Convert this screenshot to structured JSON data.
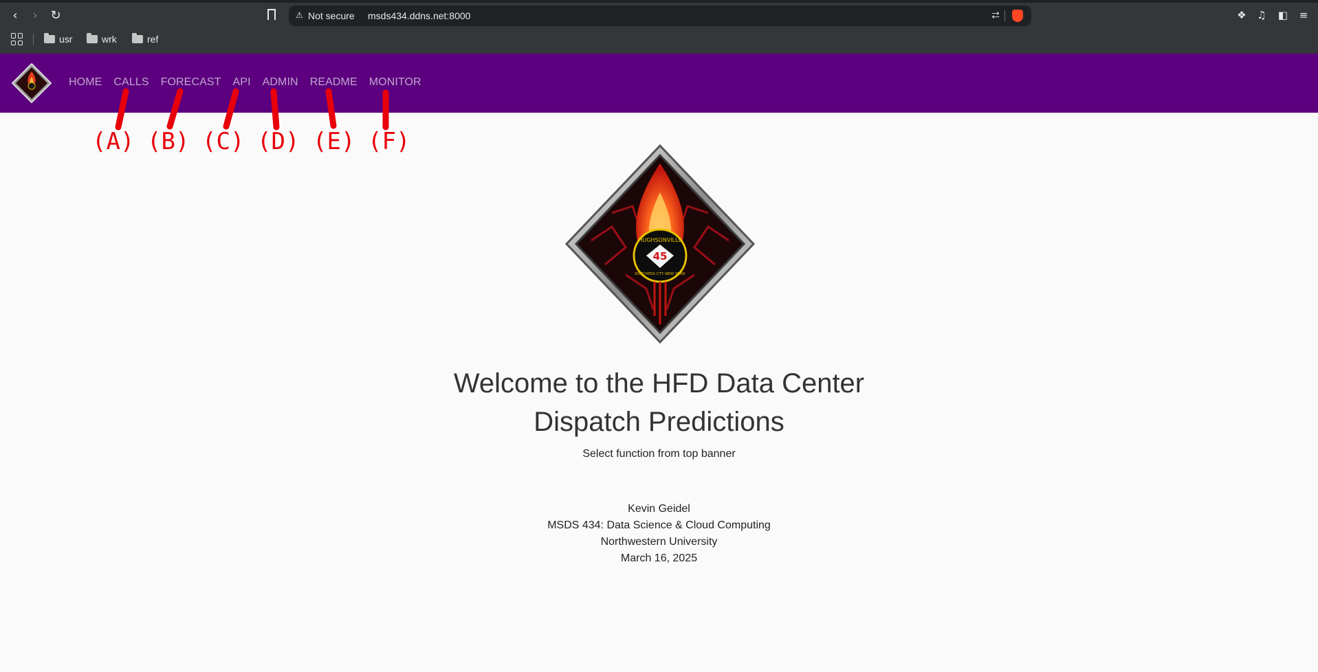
{
  "browser": {
    "security_label": "Not secure",
    "url": "msds434.ddns.net:8000",
    "bookmarks": [
      {
        "label": "usr"
      },
      {
        "label": "wrk"
      },
      {
        "label": "ref"
      }
    ]
  },
  "site": {
    "nav": [
      {
        "label": "HOME"
      },
      {
        "label": "CALLS"
      },
      {
        "label": "FORECAST"
      },
      {
        "label": "API"
      },
      {
        "label": "ADMIN"
      },
      {
        "label": "README"
      },
      {
        "label": "MONITOR"
      }
    ],
    "badge_text_top": "HUGHSONVILLE",
    "badge_number": "45",
    "badge_text_bottom": "DUTCHESS CTY NEW YORK",
    "title_line1": "Welcome to the HFD Data Center",
    "title_line2": "Dispatch Predictions",
    "subtitle": "Select function from top banner",
    "author": "Kevin Geidel",
    "course": "MSDS 434: Data Science & Cloud Computing",
    "school": "Northwestern University",
    "date": "March 16, 2025"
  },
  "annotations": [
    {
      "label": "(A)"
    },
    {
      "label": "(B)"
    },
    {
      "label": "(C)"
    },
    {
      "label": "(D)"
    },
    {
      "label": "(E)"
    },
    {
      "label": "(F)"
    }
  ],
  "colors": {
    "banner": "#5c007f",
    "nav_text": "#c2a6cf",
    "annotation": "#e8000b",
    "page_bg": "#fafafa"
  }
}
